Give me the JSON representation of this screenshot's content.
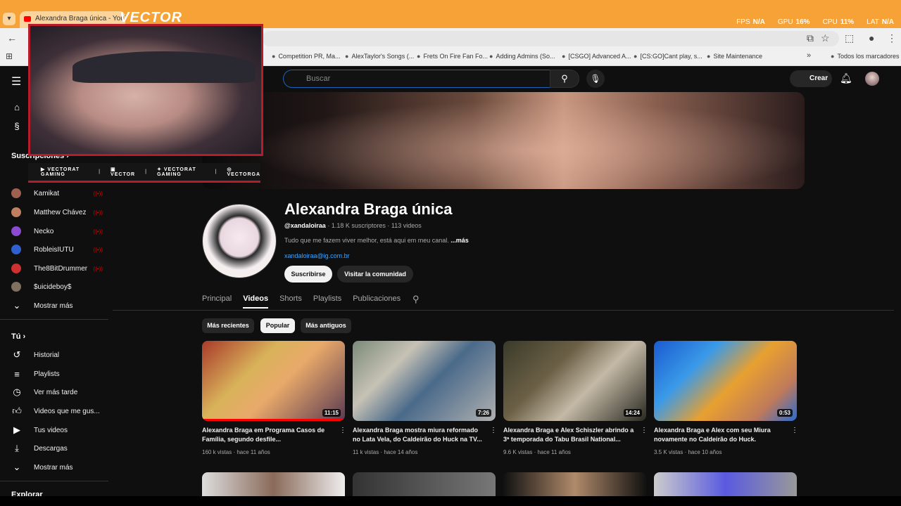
{
  "browser": {
    "tab_title": "Alexandra Braga única - YouTube",
    "bookmarks": [
      "Competition PR, Ma...",
      "AlexTaylor's Songs (...",
      "Frets On Fire Fan Fo...",
      "Adding Admins (So...",
      "[CSGO] Advanced A...",
      "[CS:GO]Cant play, s...",
      "Site Maintenance",
      "Todos los marcadores"
    ],
    "stats": [
      {
        "label": "FPS",
        "value": "N/A"
      },
      {
        "label": "GPU",
        "value": "16%"
      },
      {
        "label": "CPU",
        "value": "11%"
      },
      {
        "label": "LAT",
        "value": "N/A"
      }
    ]
  },
  "overlay": {
    "brand": "VECTOR",
    "socials": [
      "VECTORAT GAMING",
      "VECTOR",
      "VECTORAT GAMING",
      "VECTORGA"
    ]
  },
  "header": {
    "search_placeholder": "Buscar",
    "create_label": "Crear"
  },
  "sidebar": {
    "subs_heading": "Suscripciones",
    "channels": [
      {
        "name": "Kamikat",
        "live": true,
        "color": "#a06050"
      },
      {
        "name": "Matthew Chávez",
        "live": true,
        "color": "#c08060"
      },
      {
        "name": "Necko",
        "live": true,
        "color": "#8a4bd0"
      },
      {
        "name": "RobleisIUTU",
        "live": true,
        "color": "#3060d0"
      },
      {
        "name": "The8BitDrummer",
        "live": true,
        "color": "#d03030"
      },
      {
        "name": "$uicideboy$",
        "live": false,
        "color": "#807060"
      }
    ],
    "more_label": "Mostrar más",
    "you_heading": "Tú",
    "you_items": [
      "Historial",
      "Playlists",
      "Ver más tarde",
      "Videos que me gus...",
      "Tus videos",
      "Descargas",
      "Mostrar más"
    ],
    "explore_heading": "Explorar"
  },
  "channel": {
    "title": "Alexandra Braga única",
    "handle": "@xandaloiraa",
    "meta": "· 1.18 K suscriptores · 113 videos",
    "description": "Tudo que me fazem viver melhor, está aqui em meu canal.",
    "more": "...más",
    "link": "xandaloiraa@ig.com.br",
    "subscribe_label": "Suscribirse",
    "community_label": "Visitar la comunidad",
    "tabs": [
      "Principal",
      "Videos",
      "Shorts",
      "Playlists",
      "Publicaciones"
    ],
    "active_tab": "Videos",
    "chips": [
      "Más recientes",
      "Popular",
      "Más antiguos"
    ],
    "active_chip": "Popular"
  },
  "videos": [
    {
      "title": "Alexandra Braga em Programa Casos de Família, segundo desfile...",
      "views": "160 k vistas",
      "age": "hace 11 años",
      "duration": "11:15",
      "progress": 1.0
    },
    {
      "title": "Alexandra Braga mostra miura reformado no Lata Vela, do Caldeirão do Huck na TV...",
      "views": "11 k vistas",
      "age": "hace 14 años",
      "duration": "7:26",
      "progress": 0
    },
    {
      "title": "Alexandra Braga e Alex Schiszler abrindo a 3ª temporada do Tabu Brasil National...",
      "views": "9.6 K vistas",
      "age": "hace 11 años",
      "duration": "14:24",
      "progress": 0
    },
    {
      "title": "Alexandra Braga e Alex com seu Miura novamente no Caldeirão do Huck.",
      "views": "3.5 K vistas",
      "age": "hace 10 años",
      "duration": "0:53",
      "progress": 0
    }
  ]
}
